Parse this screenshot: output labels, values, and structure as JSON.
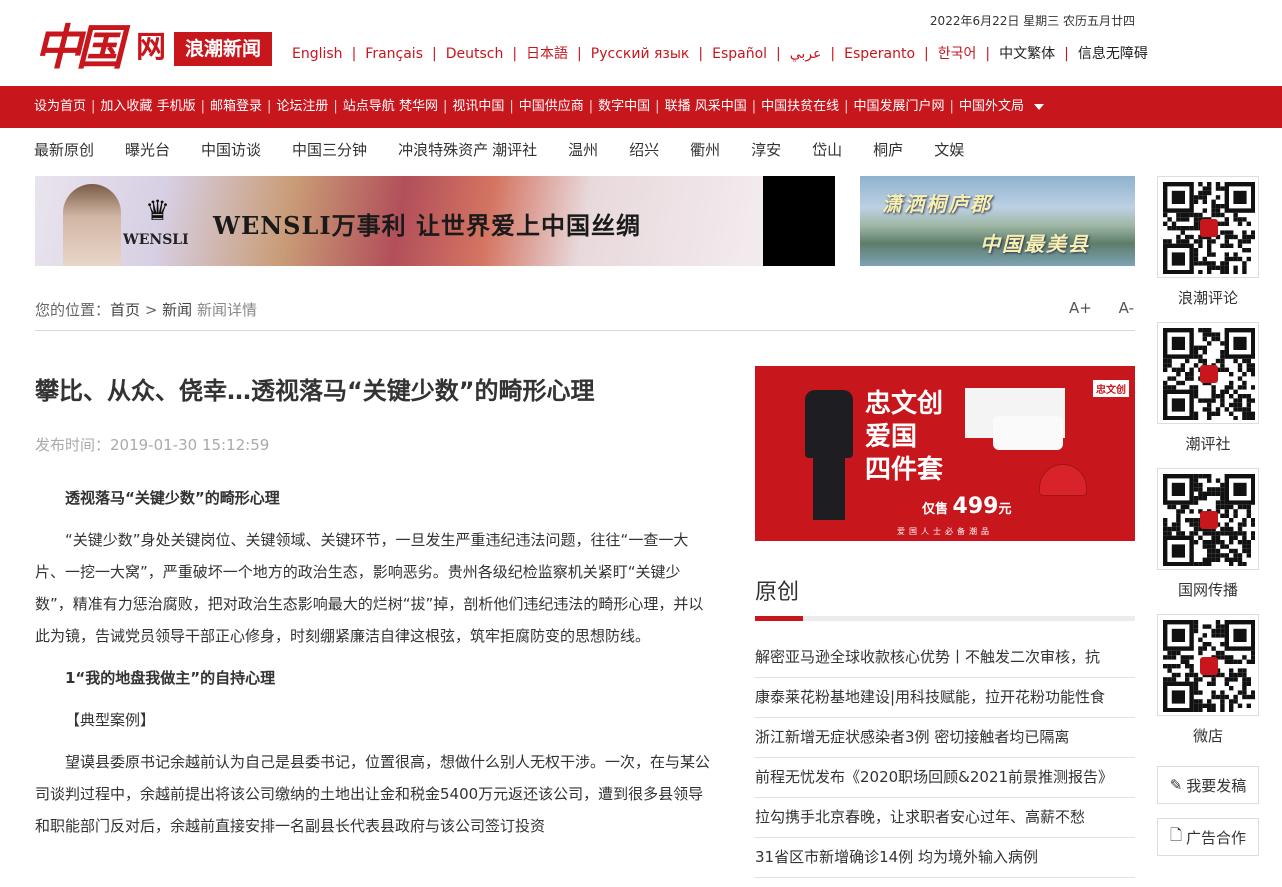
{
  "header": {
    "logo_main": "中国",
    "logo_wang": "网",
    "logo_sub": "浪潮新闻",
    "date": "2022年6月22日 星期三 农历五月廿四",
    "languages": [
      {
        "label": "English",
        "dark": false
      },
      {
        "label": "Français",
        "dark": false
      },
      {
        "label": "Deutsch",
        "dark": false
      },
      {
        "label": "日本語",
        "dark": false
      },
      {
        "label": "Русский язык",
        "dark": false
      },
      {
        "label": "Español",
        "dark": false
      },
      {
        "label": "عربي",
        "dark": false
      },
      {
        "label": "Esperanto",
        "dark": false
      },
      {
        "label": "한국어",
        "dark": false
      },
      {
        "label": "中文繁体",
        "dark": true
      },
      {
        "label": "信息无障碍",
        "dark": true
      }
    ],
    "separator": "|"
  },
  "rednav": {
    "items": [
      "设为首页",
      "加入收藏",
      "手机版",
      "邮箱登录",
      "论坛注册",
      "站点导航",
      "梵华网",
      "视讯中国",
      "中国供应商",
      "数字中国",
      "联播",
      "风采中国",
      "中国扶贫在线",
      "中国发展门户网",
      "中国外文局"
    ],
    "separator": "|",
    "no_sep_after": [
      1,
      5,
      10
    ]
  },
  "subnav": {
    "items": [
      "最新原创",
      "曝光台",
      "中国访谈",
      "中国三分钟",
      "冲浪特殊资产",
      "潮评社",
      "温州",
      "绍兴",
      "衢州",
      "淳安",
      "岱山",
      "桐庐",
      "文娱"
    ]
  },
  "banners": {
    "wensli_brand": "WENSLI",
    "wensli_slogan": "WENSLI万事利  让世界爱上中国丝绸",
    "tonglu_line1": "潇洒桐庐郡",
    "tonglu_line2": "中国最美县"
  },
  "breadcrumb": {
    "prefix": "您的位置：",
    "home": "首页",
    "arrow": ">",
    "news": "新闻",
    "current": "新闻详情"
  },
  "fontctl": {
    "increase": "A+",
    "decrease": "A-"
  },
  "article": {
    "title": "攀比、从众、侥幸…透视落马“关键少数”的畸形心理",
    "published": "发布时间：2019-01-30 15:12:59",
    "paragraphs": [
      {
        "text": "透视落马“关键少数”的畸形心理",
        "bold": true
      },
      {
        "text": "“关键少数”身处关键岗位、关键领域、关键环节，一旦发生严重违纪违法问题，往往“一查一大片、一挖一大窝”，严重破坏一个地方的政治生态，影响恶劣。贵州各级纪检监察机关紧盯“关键少数”，精准有力惩治腐败，把对政治生态影响最大的烂树“拔”掉，剖析他们违纪违法的畸形心理，并以此为镜，告诫党员领导干部正心修身，时刻绷紧廉洁自律这根弦，筑牢拒腐防变的思想防线。",
        "bold": false
      },
      {
        "text": "1“我的地盘我做主”的自持心理",
        "bold": true
      },
      {
        "text": "【典型案例】",
        "bold": false
      },
      {
        "text": "望谟县委原书记余越前认为自己是县委书记，位置很高，想做什么别人无权干涉。一次，在与某公司谈判过程中，余越前提出将该公司缴纳的土地出让金和税金5400万元返还该公司，遭到很多县领导和职能部门反对后，余越前直接安排一名副县长代表县政府与该公司签订投资",
        "bold": false
      }
    ]
  },
  "ad": {
    "title_lines": [
      "忠文创",
      "爱国",
      "四件套"
    ],
    "brand": "忠文创",
    "price_prefix": "仅售",
    "price": "499",
    "price_unit": "元",
    "bottom": "爱国人士必备潮品"
  },
  "original": {
    "heading": "原创",
    "items": [
      "解密亚马逊全球收款核心优势丨不触发二次审核，抗",
      "康泰莱花粉基地建设|用科技赋能，拉开花粉功能性食",
      "浙江新增无症状感染者3例 密切接触者均已隔离",
      "前程无忧发布《2020职场回顾&2021前景推测报告》",
      "拉勾携手北京春晚，让求职者安心过年、高薪不愁",
      "31省区市新增确诊14例 均为境外输入病例"
    ]
  },
  "qr_column": {
    "items": [
      {
        "label": "浪潮评论",
        "icon": "qr-code-icon"
      },
      {
        "label": "潮评社",
        "icon": "qr-code-icon"
      },
      {
        "label": "国网传播",
        "icon": "qr-code-icon"
      },
      {
        "label": "微店",
        "icon": "qr-code-icon"
      }
    ],
    "submit_label": "我要发稿",
    "ad_label": "广告合作"
  },
  "colors": {
    "brand_red": "#c8161d",
    "text": "#333333",
    "muted": "#aaaaaa"
  }
}
